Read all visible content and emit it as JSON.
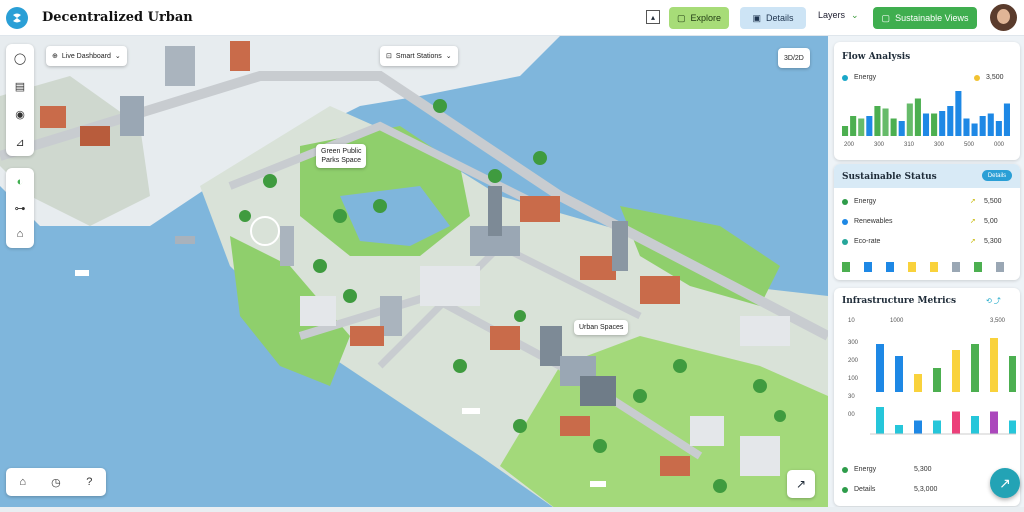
{
  "header": {
    "title": "Decentralized Urban",
    "btn1_label": "Explore",
    "btn2_label": "Details",
    "dropdown_label": "Layers",
    "btn3_label": "Sustainable Views"
  },
  "map": {
    "chip1": "Live Dashboard",
    "chip2": "Smart Stations",
    "zoom_label": "3D/2D",
    "pin1": [
      "Green Public",
      "Parks Space"
    ],
    "pin2": "Urban Spaces"
  },
  "panel1": {
    "title": "Flow Analysis",
    "legend": [
      {
        "label": "Energy",
        "value": "3,500",
        "color": "#1aa7c8"
      },
      {
        "label": "",
        "value": "",
        "color": "#f1c232"
      }
    ],
    "chart_data": {
      "type": "bar",
      "values": [
        4,
        8,
        7,
        8,
        12,
        11,
        7,
        6,
        13,
        15,
        9,
        9,
        10,
        12,
        18,
        7,
        5,
        8,
        9,
        6,
        13
      ],
      "colors": [
        "#4caf50",
        "#4caf50",
        "#66bb6a",
        "#1e88e5",
        "#4caf50",
        "#66bb6a",
        "#4caf50",
        "#1e88e5",
        "#66bb6a",
        "#4caf50",
        "#1e88e5",
        "#4caf50",
        "#1e88e5",
        "#1e88e5",
        "#1e88e5",
        "#1e88e5",
        "#1e88e5",
        "#1e88e5",
        "#1e88e5",
        "#1e88e5",
        "#1e88e5"
      ],
      "ticks": [
        "200",
        "300",
        "310",
        "300",
        "500",
        "000"
      ]
    }
  },
  "panel2": {
    "title": "Sustainable Status",
    "pill": "Details",
    "rows": [
      {
        "label": "Energy",
        "value": "5,500",
        "color": "#2e9c4a"
      },
      {
        "label": "Renewables",
        "value": "5,00",
        "color": "#1e88e5"
      },
      {
        "label": "Eco-rate",
        "value": "5,300",
        "color": "#26a69a"
      }
    ]
  },
  "panel3": {
    "title": "Infrastructure Metrics",
    "axis_top": [
      "10",
      "1000",
      "3,500"
    ],
    "axis_left": [
      "300",
      "200",
      "100",
      "30",
      "00"
    ],
    "chart_top": {
      "type": "bar",
      "values": [
        16,
        12,
        6,
        8,
        14,
        16,
        18,
        12
      ],
      "colors": [
        "#1e88e5",
        "#1e88e5",
        "#f9d23c",
        "#4caf50",
        "#f9d23c",
        "#4caf50",
        "#f9d23c",
        "#4caf50"
      ]
    },
    "chart_bottom": {
      "type": "bar",
      "values": [
        6,
        2,
        3,
        3,
        5,
        4,
        5,
        3
      ],
      "colors": [
        "#26c6da",
        "#26c6da",
        "#1e88e5",
        "#26c6da",
        "#ec407a",
        "#26c6da",
        "#ab47bc",
        "#26c6da"
      ]
    },
    "rows": [
      {
        "label": "Energy",
        "value": "5,300",
        "color": "#2e9c4a"
      },
      {
        "label": "Details",
        "value": "5,3,000",
        "color": "#2e9c4a"
      }
    ]
  }
}
